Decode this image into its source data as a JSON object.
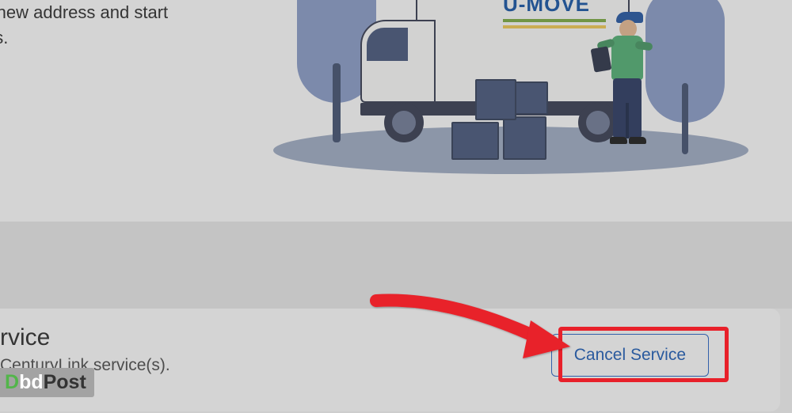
{
  "top": {
    "line1": "ur new address and start",
    "line2": "ces."
  },
  "truck": {
    "brand": "U-MOVE"
  },
  "cancel_card": {
    "title_fragment": "rvice",
    "subtitle_fragment": "CenturyLink service(s).",
    "button_label": "Cancel Service"
  },
  "watermark": {
    "part1": "D",
    "part2": "bd",
    "part3": "Post"
  }
}
